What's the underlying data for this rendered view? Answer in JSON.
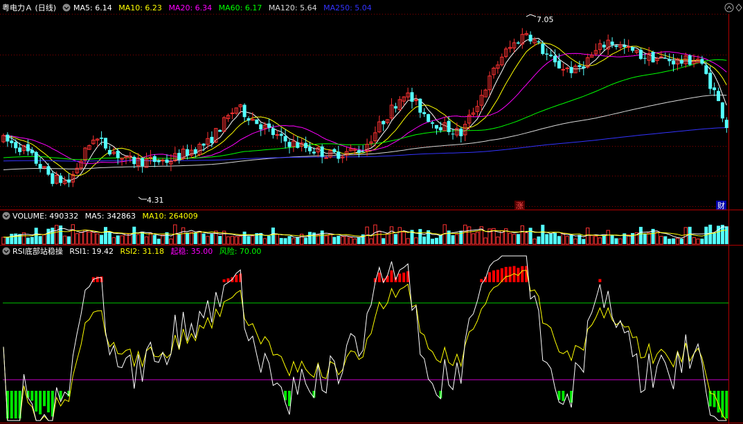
{
  "header": {
    "stock_name": "粤电力Ａ",
    "period": "(日线)",
    "ma_labels": [
      {
        "text": "MA5: 6.14",
        "color": "#ffffff"
      },
      {
        "text": "MA10: 6.23",
        "color": "#ffff00"
      },
      {
        "text": "MA20: 6.34",
        "color": "#ff00ff"
      },
      {
        "text": "MA60: 6.17",
        "color": "#00ff00"
      },
      {
        "text": "MA120: 5.64",
        "color": "#d8d8d8"
      },
      {
        "text": "MA250: 5.04",
        "color": "#3333ff"
      }
    ]
  },
  "volume_header": {
    "labels": [
      {
        "text": "VOLUME: 490332",
        "color": "#ffffff"
      },
      {
        "text": "MA5: 342863",
        "color": "#ffffff"
      },
      {
        "text": "MA10: 264009",
        "color": "#ffff00"
      }
    ]
  },
  "rsi_header": {
    "title": "RSI底部站稳操",
    "labels": [
      {
        "text": "RSI1: 19.42",
        "color": "#ffffff"
      },
      {
        "text": "RSI2: 31.18",
        "color": "#ffff00"
      },
      {
        "text": "起稳: 35.00",
        "color": "#ff00ff"
      },
      {
        "text": "风险: 70.00",
        "color": "#00ff00"
      }
    ]
  },
  "markers": {
    "zhang": "涨",
    "cai": "财"
  },
  "colors": {
    "up": "#ff3232",
    "down": "#54ffff",
    "grid": "#8b0000",
    "border": "#b00000"
  },
  "chart_data": [
    {
      "type": "candlestick",
      "title": "粤电力Ａ (日线)",
      "annotations": [
        {
          "text": "7.05",
          "value": 7.05,
          "kind": "period-high"
        },
        {
          "text": "4.31",
          "value": 4.31,
          "kind": "period-low"
        }
      ],
      "ylim": [
        4.1,
        7.3
      ],
      "bars": 178,
      "series": [
        {
          "name": "MA5",
          "value": 6.14
        },
        {
          "name": "MA10",
          "value": 6.23
        },
        {
          "name": "MA20",
          "value": 6.34
        },
        {
          "name": "MA60",
          "value": 6.17
        },
        {
          "name": "MA120",
          "value": 5.64
        },
        {
          "name": "MA250",
          "value": 5.04
        }
      ]
    },
    {
      "type": "bar",
      "title": "VOLUME",
      "series": [
        {
          "name": "VOLUME",
          "value": 490332
        },
        {
          "name": "MA5",
          "value": 342863
        },
        {
          "name": "MA10",
          "value": 264009
        }
      ]
    },
    {
      "type": "line",
      "title": "RSI底部站稳操",
      "ylim": [
        0,
        100
      ],
      "reference_lines": [
        {
          "name": "起稳",
          "value": 35.0
        },
        {
          "name": "风险",
          "value": 70.0
        }
      ],
      "series": [
        {
          "name": "RSI1",
          "value": 19.42
        },
        {
          "name": "RSI2",
          "value": 31.18
        }
      ]
    }
  ]
}
